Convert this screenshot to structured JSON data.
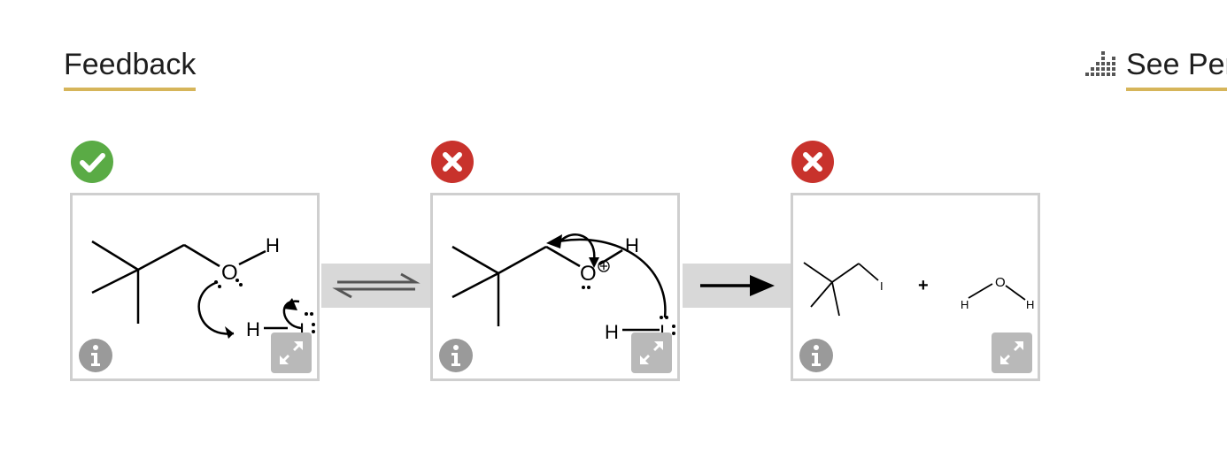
{
  "tabs": {
    "feedback": "Feedback",
    "see_performance": "See Per"
  },
  "icons": {
    "performance": "bar-chart-icon",
    "correct": "check-circle-icon",
    "incorrect": "x-circle-icon",
    "info": "info-icon",
    "expand": "expand-icon"
  },
  "colors": {
    "correct": "#5aab45",
    "incorrect": "#c8322c",
    "accent": "#d6b55a",
    "icon_grey": "#9a9a9a"
  },
  "steps": [
    {
      "status": "correct",
      "atoms": {
        "O": "O",
        "H_top": "H",
        "H": "H",
        "I": "I"
      }
    },
    {
      "status": "incorrect",
      "atoms": {
        "O": "O",
        "H_top": "H",
        "H": "H",
        "I": "I"
      }
    },
    {
      "status": "incorrect",
      "atoms": {
        "I": "I",
        "plus": "+",
        "O": "O",
        "H_left": "H",
        "H_right": "H"
      }
    }
  ]
}
